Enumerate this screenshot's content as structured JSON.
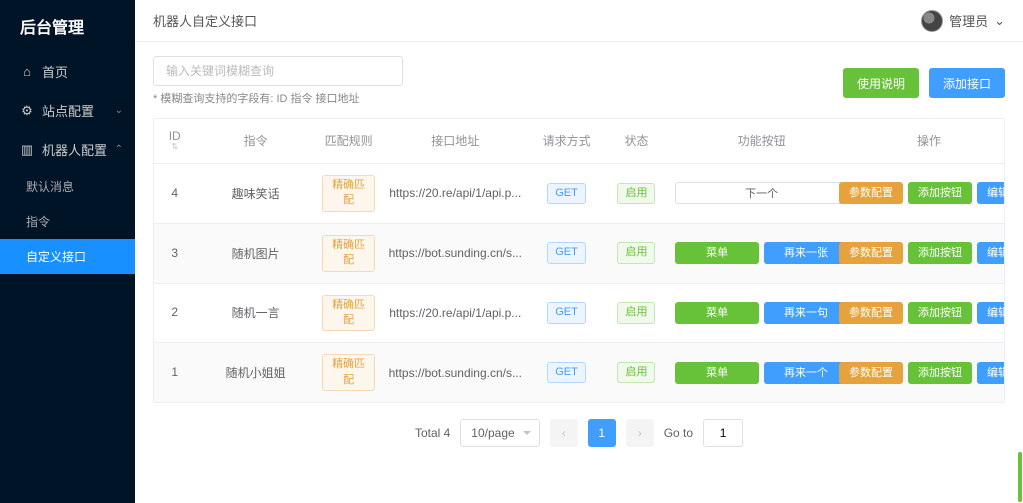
{
  "brand": "后台管理",
  "nav": {
    "home": "首页",
    "site": "站点配置",
    "bot": "机器人配置",
    "sub_default": "默认消息",
    "sub_cmd": "指令",
    "sub_custom": "自定义接口"
  },
  "crumb": "机器人自定义接口",
  "user": {
    "name": "管理员",
    "chev": "⌄"
  },
  "search": {
    "placeholder": "输入关键词模糊查询",
    "hint": "* 模糊查询支持的字段有: ID 指令 接口地址"
  },
  "actions": {
    "help": "使用说明",
    "add": "添加接口"
  },
  "columns": {
    "id": "ID",
    "sort": "⇅",
    "cmd": "指令",
    "rule": "匹配规则",
    "url": "接口地址",
    "method": "请求方式",
    "status": "状态",
    "func": "功能按钮",
    "op": "操作"
  },
  "labels": {
    "menu": "菜单",
    "next_one": "下一个",
    "again_one": "再来一张",
    "again_sen": "再来一句",
    "again_ge": "再来一个",
    "param": "参数配置",
    "add_btn": "添加按钮",
    "edit": "编辑"
  },
  "rows": [
    {
      "id": "4",
      "cmd": "趣味笑话",
      "rule": "精确匹配",
      "url": "https://20.re/api/1/api.p...",
      "method": "GET",
      "status": "启用",
      "func": [
        "next_one_outline"
      ],
      "op": [
        "param",
        "add_btn",
        "edit"
      ]
    },
    {
      "id": "3",
      "cmd": "随机图片",
      "rule": "精确匹配",
      "url": "https://bot.sunding.cn/s...",
      "method": "GET",
      "status": "启用",
      "func": [
        "menu",
        "again_one"
      ],
      "op": [
        "param",
        "add_btn",
        "edit"
      ]
    },
    {
      "id": "2",
      "cmd": "随机一言",
      "rule": "精确匹配",
      "url": "https://20.re/api/1/api.p...",
      "method": "GET",
      "status": "启用",
      "func": [
        "menu",
        "again_sen"
      ],
      "op": [
        "param",
        "add_btn",
        "edit"
      ]
    },
    {
      "id": "1",
      "cmd": "随机小姐姐",
      "rule": "精确匹配",
      "url": "https://bot.sunding.cn/s...",
      "method": "GET",
      "status": "启用",
      "func": [
        "menu",
        "again_ge"
      ],
      "op": [
        "param",
        "add_btn",
        "edit"
      ]
    }
  ],
  "pager": {
    "total": "Total 4",
    "size": "10/page",
    "current": "1",
    "goto_label": "Go to",
    "goto_value": "1",
    "prev": "‹",
    "next": "›"
  }
}
